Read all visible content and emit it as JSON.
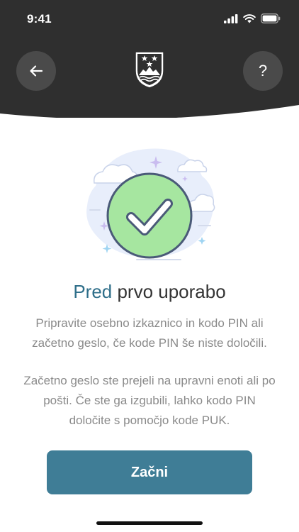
{
  "status_bar": {
    "time": "9:41",
    "icons": [
      "signal-icon",
      "wifi-icon",
      "battery-icon"
    ]
  },
  "header": {
    "back_icon": "arrow-left-icon",
    "help_label": "?",
    "logo": "slovenia-coat-of-arms"
  },
  "main": {
    "title_accent": "Pred",
    "title_rest": " prvo uporabo",
    "paragraph1": "Pripravite osebno izkaznico in kodo PIN ali začetno geslo, če kode PIN še niste določili.",
    "paragraph2": "Začetno geslo ste prejeli na upravni enoti ali po pošti. Če ste ga izgubili, lahko kodo PIN določite s pomočjo kode PUK."
  },
  "actions": {
    "start_label": "Začni"
  },
  "colors": {
    "header_bg": "#2f2f2f",
    "accent": "#2f6f8a",
    "button_bg": "#3f7d96",
    "check_green": "#a6e6a0"
  }
}
